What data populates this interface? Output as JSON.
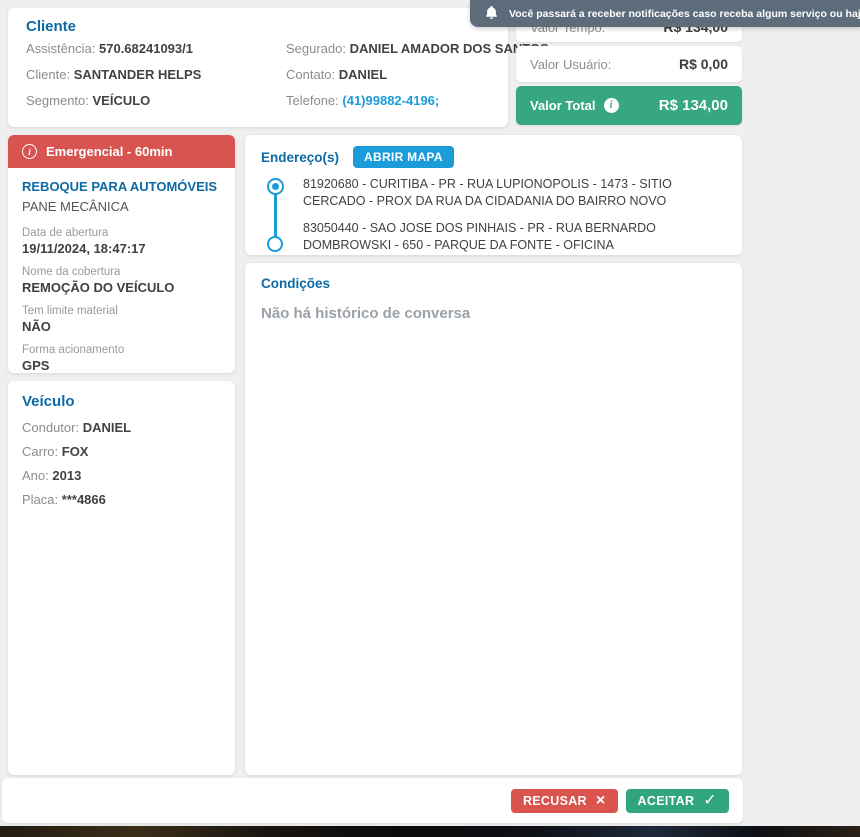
{
  "notification": {
    "text": "Você passará a receber notificações caso receba algum serviço ou haja altera"
  },
  "cliente": {
    "title": "Cliente",
    "fields_left": [
      {
        "label": "Assistência:",
        "value": "570.68241093/1"
      },
      {
        "label": "Cliente:",
        "value": "SANTANDER HELPS"
      },
      {
        "label": "Segmento:",
        "value": "VEÍCULO"
      }
    ],
    "fields_right": [
      {
        "label": "Segurado:",
        "value": "DANIEL AMADOR DOS SANTOS"
      },
      {
        "label": "Contato:",
        "value": "DANIEL"
      },
      {
        "label": "Telefone:",
        "value": "(41)99882-4196;"
      }
    ]
  },
  "valores": {
    "tempo": {
      "label": "Valor Tempo:",
      "value": "R$ 134,00"
    },
    "usuario": {
      "label": "Valor Usuário:",
      "value": "R$ 0,00"
    },
    "total": {
      "label": "Valor Total",
      "value": "R$ 134,00",
      "info_glyph": "i"
    }
  },
  "servico": {
    "banner": "Emergencial - 60min",
    "banner_info_glyph": "i",
    "title": "REBOQUE PARA AUTOMÓVEIS",
    "subtitle": "PANE MECÂNICA",
    "fields": [
      {
        "label": "Data de abertura",
        "value": "19/11/2024, 18:47:17"
      },
      {
        "label": "Nome da cobertura",
        "value": "REMOÇÃO DO VEÍCULO"
      },
      {
        "label": "Tem limite material",
        "value": "NÃO"
      },
      {
        "label": "Forma acionamento",
        "value": "GPS"
      }
    ]
  },
  "veiculo": {
    "title": "Veículo",
    "fields": [
      {
        "label": "Condutor:",
        "value": "DANIEL"
      },
      {
        "label": "Carro:",
        "value": "FOX"
      },
      {
        "label": "Ano:",
        "value": "2013"
      },
      {
        "label": "Placa:",
        "value": "***4866"
      }
    ]
  },
  "enderecos": {
    "title": "Endereço(s)",
    "map_button": "ABRIR MAPA",
    "items": [
      "81920680 - CURITIBA - PR - RUA LUPIONOPOLIS - 1473 - SITIO CERCADO - PROX DA RUA DA CIDADANIA DO BAIRRO NOVO",
      "83050440 - SAO JOSE DOS PINHAIS - PR - RUA BERNARDO DOMBROWSKI - 650 - PARQUE DA FONTE - OFICINA"
    ]
  },
  "condicoes": {
    "title": "Condições",
    "empty_message": "Não há histórico de conversa"
  },
  "footer": {
    "recusar": "RECUSAR",
    "recusar_glyph": "×",
    "aceitar": "ACEITAR",
    "aceitar_glyph": "✓"
  },
  "colors": {
    "heading_blue": "#0c6aa4",
    "accent_blue": "#1b9cd8",
    "red": "#d9534f",
    "green_total": "#36a781",
    "green_accept": "#31a57c",
    "notification_bg": "#5d6c7b",
    "page_bg": "#efeff0"
  }
}
